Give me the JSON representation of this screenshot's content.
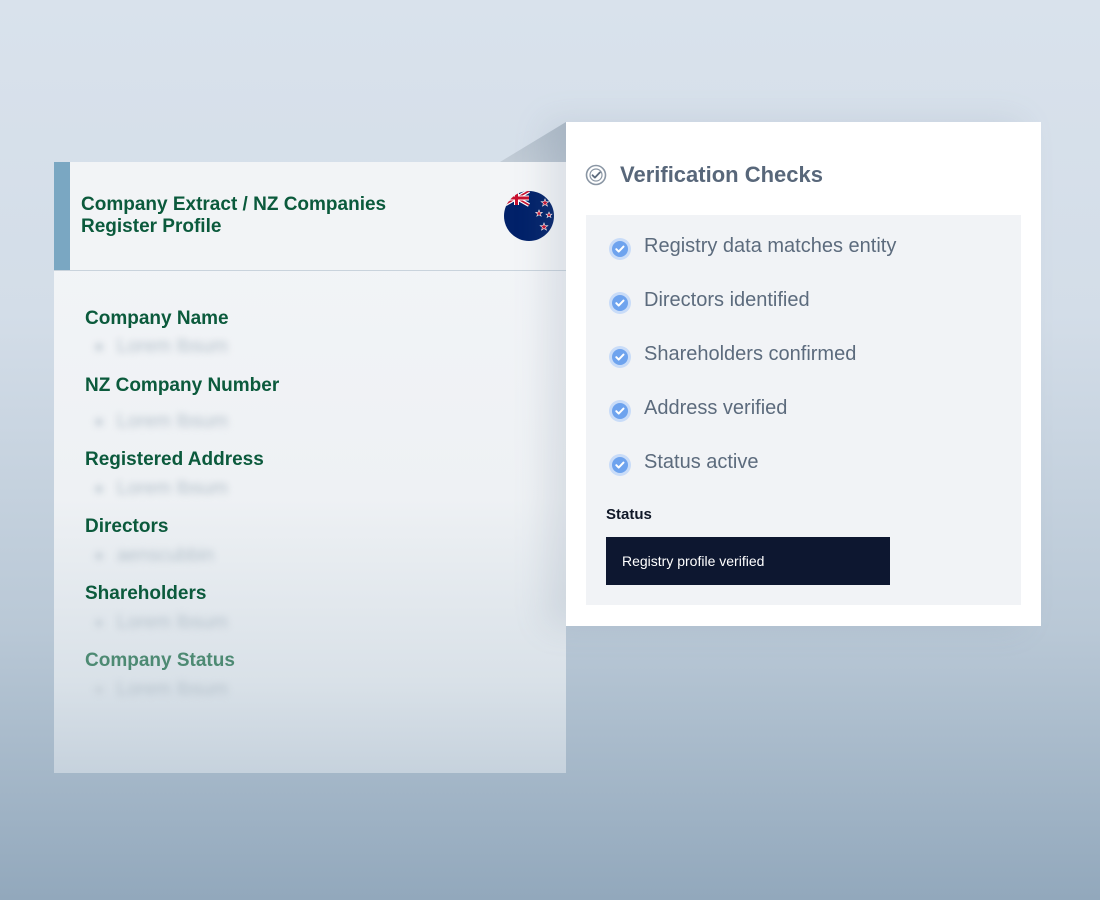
{
  "extract": {
    "title": "Company Extract / NZ Companies Register Profile",
    "flag_icon": "new-zealand-flag-icon",
    "fields": [
      {
        "label": "Company Name",
        "value": "Lorem Ibsum"
      },
      {
        "label": "NZ Company Number",
        "value": "Lorem Ibsum"
      },
      {
        "label": "Registered Address",
        "value": "Lorem Ibsum"
      },
      {
        "label": "Directors",
        "value": "aenscubbin"
      },
      {
        "label": "Shareholders",
        "value": "Lorem Ibsum"
      },
      {
        "label": "Company Status",
        "value": "Lorem Ibsum"
      }
    ]
  },
  "verification": {
    "title": "Verification Checks",
    "checks": [
      {
        "label": "Registry data matches entity"
      },
      {
        "label": "Directors identified"
      },
      {
        "label": "Shareholders confirmed"
      },
      {
        "label": "Address verified"
      },
      {
        "label": "Status active"
      }
    ],
    "status_label": "Status",
    "status_value": "Registry profile verified"
  },
  "colors": {
    "accent": "#7aa7c2",
    "label_green": "#0b5a3c",
    "check_blue": "#4f8fe6",
    "status_bg": "#0d1730"
  }
}
